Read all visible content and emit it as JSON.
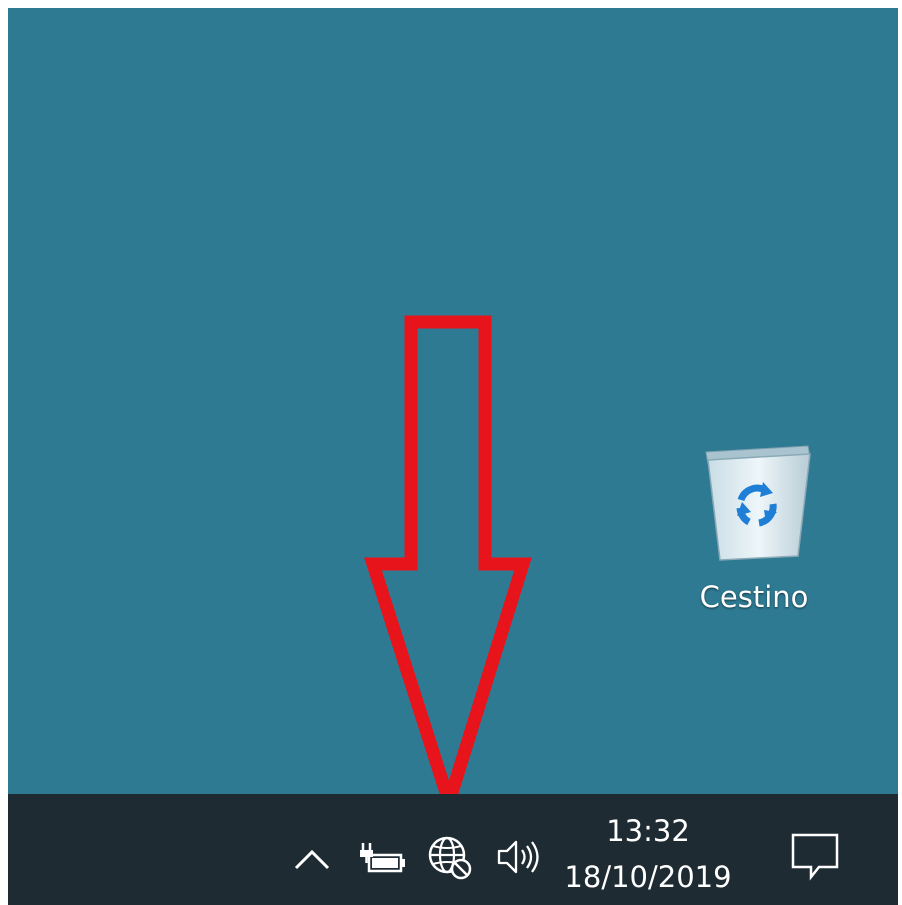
{
  "desktop": {
    "background_color": "#2e7a93",
    "icons": [
      {
        "label": "Cestino",
        "icon": "recycle-bin-icon"
      }
    ]
  },
  "annotation": {
    "type": "arrow-down",
    "color": "#e8141c",
    "points_to": "network-icon"
  },
  "taskbar": {
    "background_color": "#1f2b33",
    "tray": {
      "icons": [
        "chevron-up-icon",
        "battery-charging-icon",
        "network-no-internet-icon",
        "volume-icon"
      ]
    },
    "clock": {
      "time": "13:32",
      "date": "18/10/2019"
    },
    "action_center_icon": "notification-icon"
  }
}
